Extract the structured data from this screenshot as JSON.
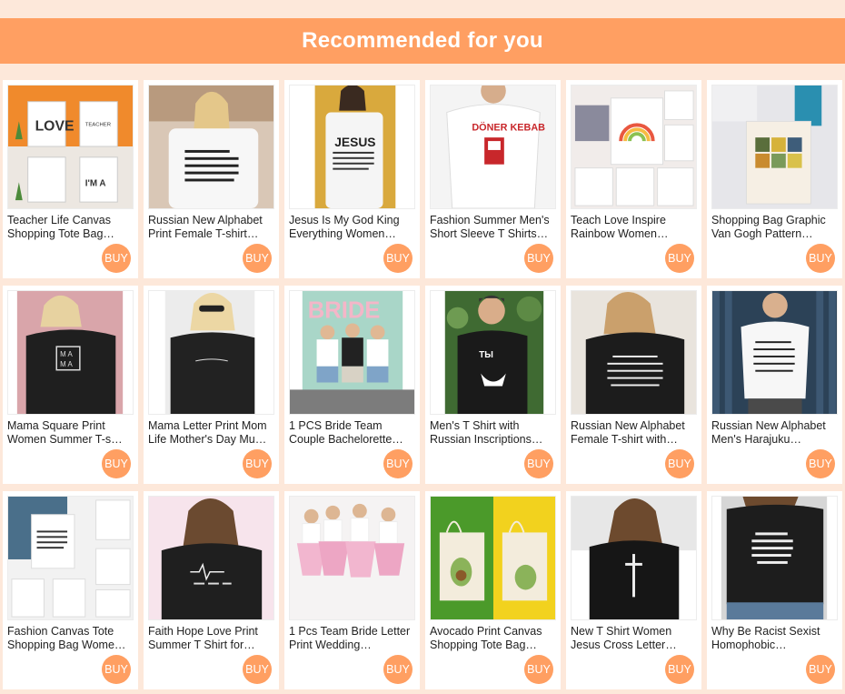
{
  "header": {
    "title": "Recommended for you"
  },
  "buy_label": "BUY",
  "colors": {
    "accent": "#ff9f62",
    "background": "#fde8da"
  },
  "products": [
    {
      "title": "Teacher Life Canvas Shopping Tote Bag…"
    },
    {
      "title": "Russian New Alphabet Print Female T-shirt…"
    },
    {
      "title": "Jesus Is My God King Everything Women…"
    },
    {
      "title": "Fashion Summer Men's Short Sleeve T Shirts…"
    },
    {
      "title": "Teach Love Inspire Rainbow Women…"
    },
    {
      "title": "Shopping Bag Graphic Van Gogh Pattern…"
    },
    {
      "title": "Mama Square Print Women Summer T-s…"
    },
    {
      "title": "Mama Letter Print Mom Life Mother's Day Mu…"
    },
    {
      "title": "1 PCS Bride Team Couple Bachelorette…"
    },
    {
      "title": "Men's T Shirt with Russian Inscriptions…"
    },
    {
      "title": "Russian New Alphabet Female T-shirt with…"
    },
    {
      "title": "Russian New Alphabet Men's Harajuku…"
    },
    {
      "title": "Fashion Canvas Tote Shopping Bag Wome…"
    },
    {
      "title": "Faith Hope Love Print Summer T Shirt for…"
    },
    {
      "title": "1 Pcs Team Bride Letter Print Wedding…"
    },
    {
      "title": "Avocado Print Canvas Shopping Tote Bag…"
    },
    {
      "title": "New T Shirt Women Jesus Cross Letter…"
    },
    {
      "title": "Why Be Racist Sexist Homophobic…"
    }
  ]
}
